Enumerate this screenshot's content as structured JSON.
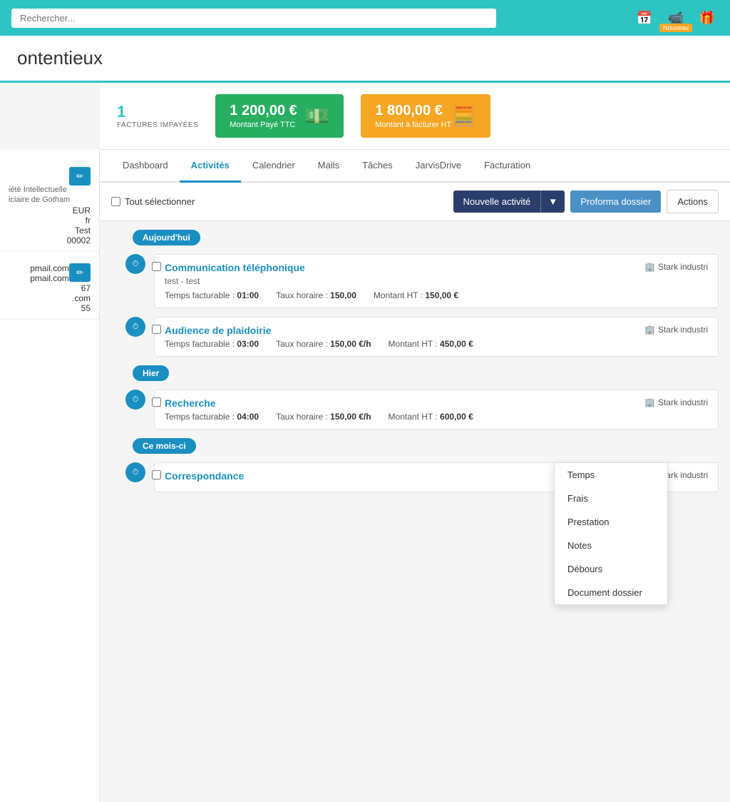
{
  "topbar": {
    "search_placeholder": "Rechercher...",
    "icons": [
      {
        "name": "calendar-icon",
        "symbol": "📅"
      },
      {
        "name": "video-icon",
        "symbol": "📹",
        "badge": "Nouveau"
      },
      {
        "name": "gift-icon",
        "symbol": "🎁"
      }
    ]
  },
  "page_title": "ontentieux",
  "stats": {
    "invoices_count": "1",
    "invoices_label": "FACTURES IMPAYÉES",
    "paid": {
      "amount": "1 200,00 €",
      "label": "Montant Payé TTC",
      "color": "green"
    },
    "to_invoice": {
      "amount": "1 800,00 €",
      "label": "Montant à facturer HT",
      "color": "orange"
    }
  },
  "sidebar": {
    "edit_icon": "✏",
    "fields": [
      {
        "label": "iété Intellectuelle",
        "value": ""
      },
      {
        "label": "iciaire de Gotham",
        "value": ""
      },
      {
        "label": "",
        "value": "EUR"
      },
      {
        "label": "",
        "value": "fr"
      },
      {
        "label": "",
        "value": "Test"
      },
      {
        "label": "",
        "value": "00002"
      }
    ],
    "edit2_icon": "✏",
    "fields2": [
      {
        "label": "",
        "value": "pmail.com"
      },
      {
        "label": "",
        "value": "pmail.com"
      },
      {
        "label": "",
        "value": "67"
      },
      {
        "label": "",
        "value": ".com"
      },
      {
        "label": "",
        "value": "55"
      }
    ]
  },
  "tabs": [
    {
      "id": "dashboard",
      "label": "Dashboard",
      "active": false
    },
    {
      "id": "activites",
      "label": "Activités",
      "active": true
    },
    {
      "id": "calendrier",
      "label": "Calendrier",
      "active": false
    },
    {
      "id": "mails",
      "label": "Mails",
      "active": false
    },
    {
      "id": "taches",
      "label": "Tâches",
      "active": false
    },
    {
      "id": "jarvisdrive",
      "label": "JarvisDrive",
      "active": false
    },
    {
      "id": "facturation",
      "label": "Facturation",
      "active": false
    }
  ],
  "toolbar": {
    "select_all_label": "Tout sélectionner",
    "nouvelle_activite_label": "Nouvelle activité",
    "proforma_label": "Proforma dossier",
    "actions_label": "Actions"
  },
  "dropdown": {
    "items": [
      {
        "id": "temps",
        "label": "Temps"
      },
      {
        "id": "frais",
        "label": "Frais"
      },
      {
        "id": "prestation",
        "label": "Prestation"
      },
      {
        "id": "notes",
        "label": "Notes"
      },
      {
        "id": "debours",
        "label": "Débours"
      },
      {
        "id": "document_dossier",
        "label": "Document dossier"
      }
    ]
  },
  "timeline": {
    "sections": [
      {
        "label": "Aujourd'hui",
        "items": [
          {
            "id": "item1",
            "title": "Communication téléphonique",
            "subtitle": "test - test",
            "company": "Stark industri",
            "temps_facturable": "01:00",
            "taux_horaire": "150,00",
            "montant_ht": "150,00 €",
            "show_montant": false
          },
          {
            "id": "item2",
            "title": "Audience de plaidoirie",
            "subtitle": "",
            "company": "Stark industri",
            "temps_facturable": "03:00",
            "taux_horaire": "150,00 €/h",
            "montant_ht": "450,00 €",
            "show_montant": true
          }
        ]
      },
      {
        "label": "Hier",
        "items": [
          {
            "id": "item3",
            "title": "Recherche",
            "subtitle": "",
            "company": "Stark industri",
            "temps_facturable": "04:00",
            "taux_horaire": "150,00 €/h",
            "montant_ht": "600,00 €",
            "show_montant": true
          }
        ]
      },
      {
        "label": "Ce mois-ci",
        "items": [
          {
            "id": "item4",
            "title": "Correspondance",
            "subtitle": "",
            "company": "Stark industri",
            "temps_facturable": "",
            "taux_horaire": "",
            "montant_ht": "",
            "show_montant": false
          }
        ]
      }
    ]
  },
  "labels": {
    "temps_facturable": "Temps facturable",
    "taux_horaire": "Taux horaire",
    "montant_ht": "Montant HT",
    "company_icon": "🏢"
  }
}
